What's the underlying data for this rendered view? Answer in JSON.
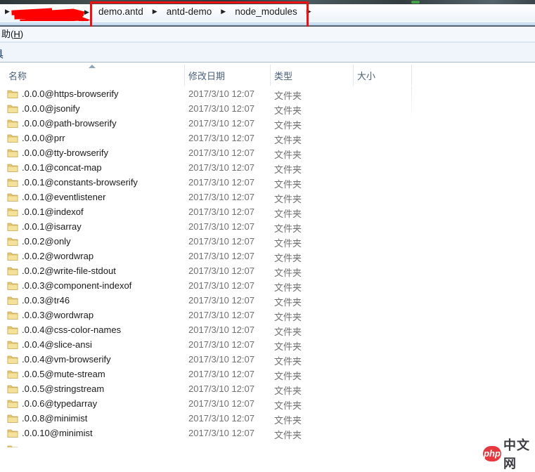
{
  "window": {
    "nav": {
      "dropdown_chevron": "▶"
    },
    "breadcrumb": {
      "chevron": "▶",
      "items": [
        "demo.antd",
        "antd-demo",
        "node_modules"
      ],
      "trailing_chevron": true,
      "redaction_color": "#ff0000",
      "annotation_box_color": "#ee1111"
    },
    "menu": {
      "help_pre": "助(",
      "help_accel": "H",
      "help_post": ")"
    },
    "toolbar": {
      "clipped_fragment": "具"
    }
  },
  "list": {
    "columns": [
      {
        "label": "名称",
        "sort": "asc"
      },
      {
        "label": "修改日期",
        "sort": ""
      },
      {
        "label": "类型",
        "sort": ""
      },
      {
        "label": "大小",
        "sort": ""
      }
    ],
    "rows": [
      {
        "name": ".0.0.0@https-browserify",
        "date": "2017/3/10 12:07",
        "type": "文件夹",
        "size": ""
      },
      {
        "name": ".0.0.0@jsonify",
        "date": "2017/3/10 12:07",
        "type": "文件夹",
        "size": ""
      },
      {
        "name": ".0.0.0@path-browserify",
        "date": "2017/3/10 12:07",
        "type": "文件夹",
        "size": ""
      },
      {
        "name": ".0.0.0@prr",
        "date": "2017/3/10 12:07",
        "type": "文件夹",
        "size": ""
      },
      {
        "name": ".0.0.0@tty-browserify",
        "date": "2017/3/10 12:07",
        "type": "文件夹",
        "size": ""
      },
      {
        "name": ".0.0.1@concat-map",
        "date": "2017/3/10 12:07",
        "type": "文件夹",
        "size": ""
      },
      {
        "name": ".0.0.1@constants-browserify",
        "date": "2017/3/10 12:07",
        "type": "文件夹",
        "size": ""
      },
      {
        "name": ".0.0.1@eventlistener",
        "date": "2017/3/10 12:07",
        "type": "文件夹",
        "size": ""
      },
      {
        "name": ".0.0.1@indexof",
        "date": "2017/3/10 12:07",
        "type": "文件夹",
        "size": ""
      },
      {
        "name": ".0.0.1@isarray",
        "date": "2017/3/10 12:07",
        "type": "文件夹",
        "size": ""
      },
      {
        "name": ".0.0.2@only",
        "date": "2017/3/10 12:07",
        "type": "文件夹",
        "size": ""
      },
      {
        "name": ".0.0.2@wordwrap",
        "date": "2017/3/10 12:07",
        "type": "文件夹",
        "size": ""
      },
      {
        "name": ".0.0.2@write-file-stdout",
        "date": "2017/3/10 12:07",
        "type": "文件夹",
        "size": ""
      },
      {
        "name": ".0.0.3@component-indexof",
        "date": "2017/3/10 12:07",
        "type": "文件夹",
        "size": ""
      },
      {
        "name": ".0.0.3@tr46",
        "date": "2017/3/10 12:07",
        "type": "文件夹",
        "size": ""
      },
      {
        "name": ".0.0.3@wordwrap",
        "date": "2017/3/10 12:07",
        "type": "文件夹",
        "size": ""
      },
      {
        "name": ".0.0.4@css-color-names",
        "date": "2017/3/10 12:07",
        "type": "文件夹",
        "size": ""
      },
      {
        "name": ".0.0.4@slice-ansi",
        "date": "2017/3/10 12:07",
        "type": "文件夹",
        "size": ""
      },
      {
        "name": ".0.0.4@vm-browserify",
        "date": "2017/3/10 12:07",
        "type": "文件夹",
        "size": ""
      },
      {
        "name": ".0.0.5@mute-stream",
        "date": "2017/3/10 12:07",
        "type": "文件夹",
        "size": ""
      },
      {
        "name": ".0.0.5@stringstream",
        "date": "2017/3/10 12:07",
        "type": "文件夹",
        "size": ""
      },
      {
        "name": ".0.0.6@typedarray",
        "date": "2017/3/10 12:07",
        "type": "文件夹",
        "size": ""
      },
      {
        "name": ".0.0.8@minimist",
        "date": "2017/3/10 12:07",
        "type": "文件夹",
        "size": ""
      },
      {
        "name": ".0.0.10@minimist",
        "date": "2017/3/10 12:07",
        "type": "文件夹",
        "size": ""
      }
    ],
    "partial_row_at_bottom": true
  },
  "icons": {
    "folder": {
      "body": "#f5e29a",
      "shade": "#e8c86e",
      "outline": "#c2a050"
    }
  },
  "watermark": {
    "badge": "php",
    "text": "中文网",
    "badge_color": "#e6393f"
  }
}
